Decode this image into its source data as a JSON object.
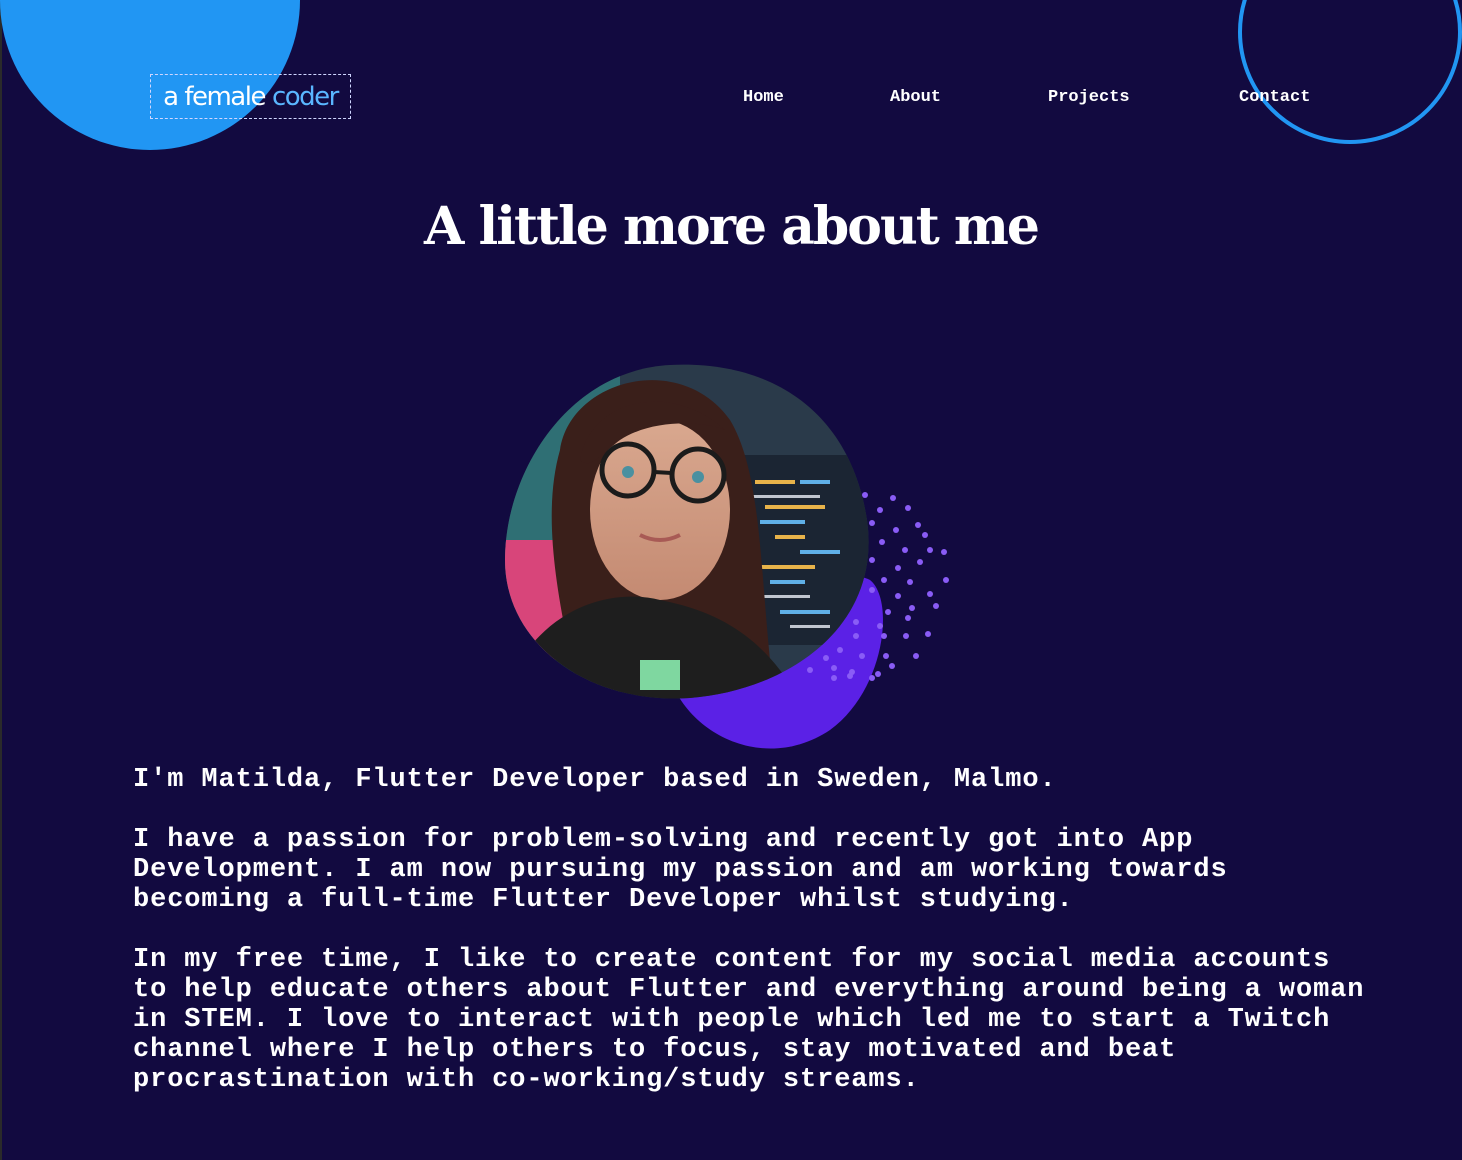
{
  "colors": {
    "background": "#120a40",
    "accent_blue": "#2196f3",
    "accent_purple": "#5b21e6",
    "dots": "#8a5cf6"
  },
  "logo": {
    "part1": "a female",
    "part2": "coder"
  },
  "nav": {
    "items": [
      {
        "label": "Home"
      },
      {
        "label": "About"
      },
      {
        "label": "Projects"
      },
      {
        "label": "Contact"
      }
    ]
  },
  "about": {
    "title": "A little more about me",
    "paragraphs": [
      "I'm Matilda, Flutter Developer based in Sweden, Malmo.",
      "I have a passion for problem-solving and recently got into App Development. I am now pursuing my passion and am working towards becoming a full-time Flutter Developer whilst studying.",
      "In my free time, I like to create content for my social media accounts to help educate others about Flutter and everything around being a woman in STEM. I love to interact with people which led me to start a Twitch channel where I help others to focus, stay motivated and beat procrastination with co-working/study streams."
    ]
  }
}
